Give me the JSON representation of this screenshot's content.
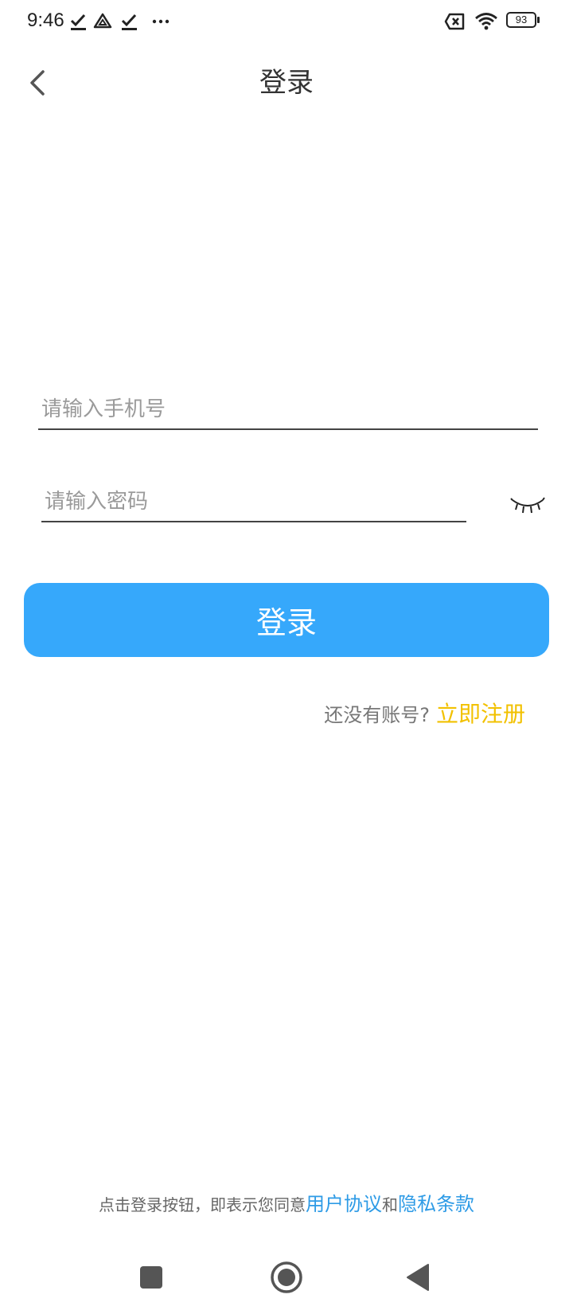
{
  "status_bar": {
    "time": "9:46",
    "battery": "93",
    "icons": [
      "check-download-icon",
      "drive-icon",
      "check-download-icon",
      "more-dots-icon",
      "sim-error-icon",
      "wifi-icon",
      "battery-icon"
    ]
  },
  "header": {
    "title": "登录",
    "back_icon": "chevron-left-icon"
  },
  "form": {
    "phone_placeholder": "请输入手机号",
    "phone_value": "",
    "password_placeholder": "请输入密码",
    "password_value": "",
    "eye_icon": "eye-closed-icon",
    "login_label": "登录"
  },
  "register": {
    "prompt": "还没有账号?",
    "link": "立即注册"
  },
  "agreement": {
    "prefix": "点击登录按钮，即表示您同意",
    "user_agreement": "用户协议",
    "conjunction": "和",
    "privacy_policy": "隐私条款"
  },
  "nav_bar": {
    "icons": [
      "square-recents-icon",
      "circle-home-icon",
      "triangle-back-icon"
    ]
  },
  "colors": {
    "primary": "#36a8fb",
    "register_link": "#f2c100",
    "agreement_link": "#2e9be6"
  }
}
